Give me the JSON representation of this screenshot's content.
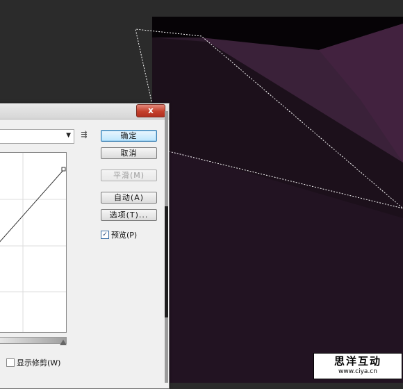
{
  "dialog": {
    "close_glyph": "x",
    "preset_caret": "▼",
    "preset_menu_icon": "⇶",
    "buttons": {
      "ok": "确定",
      "cancel": "取消",
      "smooth": "平滑(M)",
      "auto": "自动(A)",
      "options": "选项(T)..."
    },
    "preview": {
      "label": "预览(P)",
      "checked": true,
      "mark": "✓"
    },
    "show_clipping": {
      "label": "显示修剪(W)",
      "checked": false
    }
  },
  "watermark": {
    "title": "思洋互动",
    "url": "www.ciya.cn"
  },
  "colors": {
    "canvas_bg": "#211221",
    "facet_light": "#3f2340",
    "facet_mid": "#2d1b2e",
    "facet_dark": "#1a1019",
    "black": "#060306"
  }
}
